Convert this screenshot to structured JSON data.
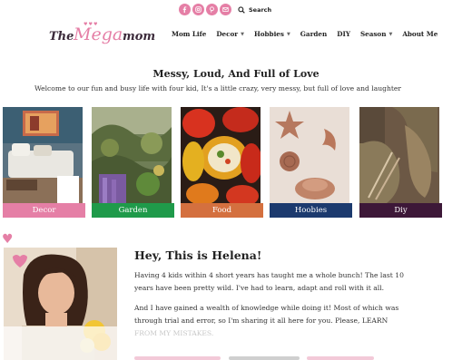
{
  "topbar": {
    "social_icons": [
      "facebook-icon",
      "instagram-icon",
      "pinterest-icon",
      "email-icon"
    ],
    "search_label": "Search"
  },
  "logo": {
    "the": "The",
    "mega": "Mega",
    "mom": "mom"
  },
  "nav": {
    "items": [
      {
        "label": "Mom Life",
        "dropdown": false
      },
      {
        "label": "Decor",
        "dropdown": true
      },
      {
        "label": "Hobbies",
        "dropdown": true
      },
      {
        "label": "Garden",
        "dropdown": false
      },
      {
        "label": "DIY",
        "dropdown": false
      },
      {
        "label": "Season",
        "dropdown": true
      },
      {
        "label": "About Me",
        "dropdown": false
      }
    ]
  },
  "intro": {
    "title": "Messy, Loud, And Full of Love",
    "subtitle": "Welcome to our fun and busy life with four kid, It's a little crazy, very messy, but full of love and laughter"
  },
  "categories": [
    {
      "label": "Decor",
      "color": "#e57fa6"
    },
    {
      "label": "Garden",
      "color": "#1f9a4a"
    },
    {
      "label": "Food",
      "color": "#d4703f"
    },
    {
      "label": "Hoobies",
      "color": "#1c3a6e"
    },
    {
      "label": "Diy",
      "color": "#3d1838"
    }
  ],
  "about": {
    "title": "Hey, This is Helena!",
    "p1": "Having 4 kids within 4 short years has taught me a whole bunch! The last 10 years have been pretty wild. I've had to learn, adapt and roll with it all.",
    "p2": "And I have gained a wealth of knowledge while doing it! Most of which was through trial and error, so I'm sharing it all here for you. Please, LEARN FROM MY MISTAKES."
  },
  "colors": {
    "accent": "#e57fa6",
    "text": "#222222"
  }
}
